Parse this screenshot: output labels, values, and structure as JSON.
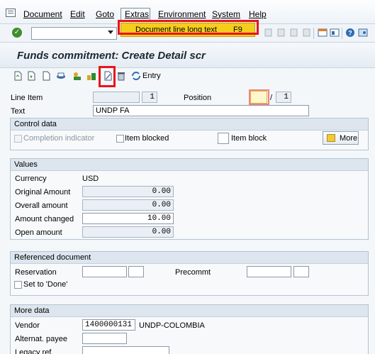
{
  "menu": {
    "items": [
      "Document",
      "Edit",
      "Goto",
      "Extras",
      "Environment",
      "System",
      "Help"
    ]
  },
  "dropdown": {
    "item_label": "Document line long text",
    "item_shortcut": "F9"
  },
  "title": "Funds commitment: Create Detail scr",
  "app_toolbar": {
    "entry_label": "Entry"
  },
  "header_fields": {
    "line_item_label": "Line Item",
    "line_item_value": "1",
    "position_label": "Position",
    "position_value": "",
    "position_sep": "/",
    "position_total": "1",
    "text_label": "Text",
    "text_value": "UNDP FA"
  },
  "control_data": {
    "title": "Control data",
    "completion_indicator": "Completion indicator",
    "item_blocked": "Item blocked",
    "item_block": "Item block",
    "more_button": "More"
  },
  "values": {
    "title": "Values",
    "currency_label": "Currency",
    "currency_value": "USD",
    "rows": [
      {
        "label": "Original Amount",
        "value": "0.00"
      },
      {
        "label": "Overall amount",
        "value": "0.00"
      },
      {
        "label": "Amount changed",
        "value": "10.00"
      },
      {
        "label": "Open amount",
        "value": "0.00"
      }
    ]
  },
  "referenced_document": {
    "title": "Referenced document",
    "reservation_label": "Reservation",
    "precommt_label": "Precommt",
    "set_done_label": "Set to 'Done'"
  },
  "more_data": {
    "title": "More data",
    "vendor_label": "Vendor",
    "vendor_value": "1400000131",
    "vendor_name": "UNDP-COLOMBIA",
    "alt_payee_label": "Alternat. payee",
    "legacy_ref_label": "Legacy ref."
  },
  "colors": {
    "highlight": "#e8141b",
    "menu_highlight": "#f7cd1d",
    "group_header": "#dde6ef"
  }
}
